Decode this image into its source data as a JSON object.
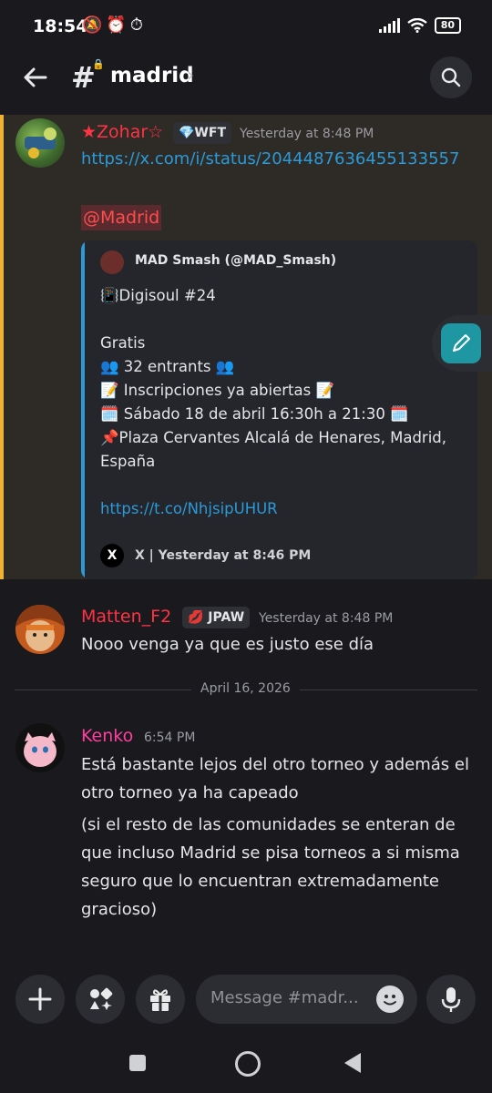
{
  "status_bar": {
    "time": "18:54",
    "left_icons": "🔕⏰⏱",
    "battery": "80"
  },
  "header": {
    "hash": "#",
    "channel_name": "madrid",
    "chevron": "›"
  },
  "messages": [
    {
      "author": "★Zohar☆",
      "author_color": "#ff3344",
      "tag": "💎WFT",
      "time": "Yesterday at 8:48 PM",
      "link": "https://x.com/i/status/2044487636455133557",
      "mention": "@Madrid",
      "embed": {
        "author": "MAD Smash (@MAD_Smash)",
        "lines": [
          "📳Digisoul #24",
          "",
          "Gratis",
          "👥 32 entrants 👥",
          "📝 Inscripciones ya abiertas 📝",
          "🗓️ Sábado 18 de abril 16:30h a 21:30 🗓️",
          "📌Plaza Cervantes Alcalá de Henares, Madrid, España",
          "",
          "https://t.co/NhjsipUHUR"
        ],
        "footer_icon": "X",
        "footer": "X | Yesterday at 8:46 PM"
      }
    },
    {
      "author": "Matten_F2",
      "author_color": "#ff3344",
      "tag": "💋 JPAW",
      "time": "Yesterday at 8:48 PM",
      "text": "Nooo venga ya que es justo ese día"
    },
    {
      "author": "Kenko",
      "author_color": "#ff3fa0",
      "time": "6:54 PM",
      "text1": "Está bastante lejos del otro torneo y además el otro torneo ya ha capeado",
      "text2": "(si el resto de las comunidades se enteran de que incluso Madrid se pisa torneos a si misma seguro que lo encuentran extremadamente gracioso)"
    }
  ],
  "date_divider": "April 16, 2026",
  "composer": {
    "placeholder": "Message #madr..."
  },
  "icons": [
    "back-arrow-icon",
    "search-icon",
    "edit-pencil-icon",
    "plus-icon",
    "apps-icon",
    "gift-icon",
    "emoji-icon",
    "microphone-icon"
  ]
}
